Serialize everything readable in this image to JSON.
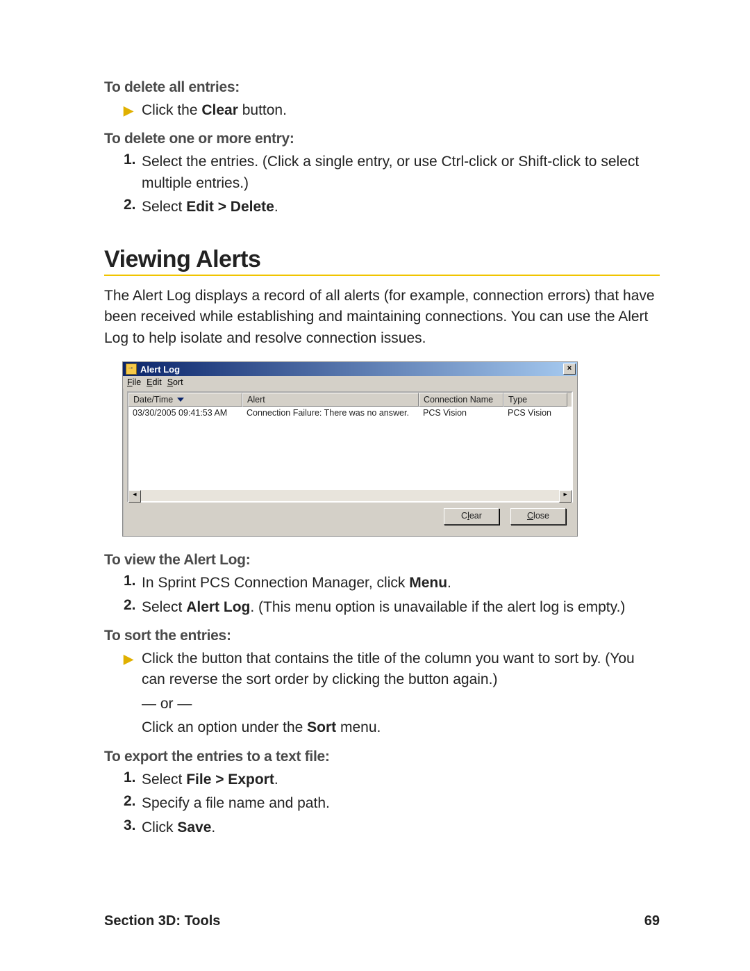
{
  "sec_delete_all_heading": "To delete all entries:",
  "delete_all_step": "Click the ",
  "delete_all_bold": "Clear",
  "delete_all_tail": " button.",
  "sec_delete_one_heading": "To delete one or more entry:",
  "delete_one_step1": "Select the entries. (Click a single entry, or use Ctrl-click or Shift-click to select multiple entries.)",
  "delete_one_step2_pre": "Select ",
  "delete_one_step2_bold": "Edit > Delete",
  "delete_one_step2_post": ".",
  "section_title": "Viewing Alerts",
  "intro_para": "The Alert Log displays a record of all alerts (for example, connection errors) that have been received while establishing and maintaining connections. You can use the Alert Log to help isolate and resolve connection issues.",
  "alert_window": {
    "title": "Alert Log",
    "menu": {
      "file": "File",
      "edit": "Edit",
      "sort": "Sort"
    },
    "cols": {
      "c1": "Date/Time",
      "c2": "Alert",
      "c3": "Connection Name",
      "c4": "Type"
    },
    "row1": {
      "c1": "03/30/2005 09:41:53 AM",
      "c2": "Connection Failure: There was no answer.",
      "c3": "PCS Vision",
      "c4": "PCS Vision"
    },
    "btn_clear": "Clear",
    "btn_close": "Close"
  },
  "sec_view_heading": "To view the Alert Log:",
  "view_step1_pre": "In Sprint PCS Connection Manager, click ",
  "view_step1_bold": "Menu",
  "view_step1_post": ".",
  "view_step2_pre": "Select ",
  "view_step2_bold": "Alert Log",
  "view_step2_post": ". (This menu option is unavailable if the alert log is empty.)",
  "sec_sort_heading": "To sort the entries:",
  "sort_step": "Click the button that contains the title of the column you want to sort by. (You can reverse the sort order by clicking the button again.)",
  "sort_or": "— or —",
  "sort_alt_pre": "Click an option under the ",
  "sort_alt_bold": "Sort",
  "sort_alt_post": " menu.",
  "sec_export_heading": "To export the entries to a text file:",
  "export_step1_pre": "Select ",
  "export_step1_bold": "File > Export",
  "export_step1_post": ".",
  "export_step2": "Specify a file name and path.",
  "export_step3_pre": "Click ",
  "export_step3_bold": "Save",
  "export_step3_post": ".",
  "footer_left": "Section 3D: Tools",
  "footer_right": "69"
}
